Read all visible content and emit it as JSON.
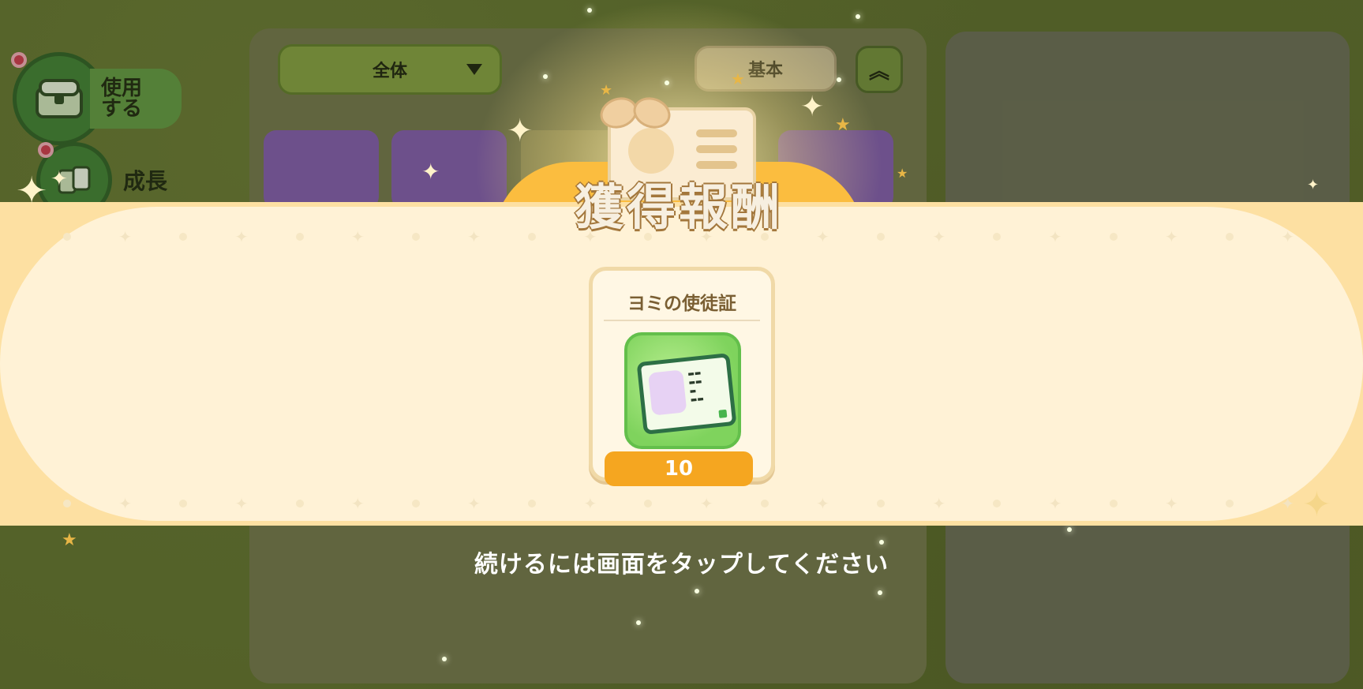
{
  "left_menu": {
    "use_label": "使用\nする",
    "growth_label": "成長"
  },
  "toolbar": {
    "filter_value": "全体",
    "sort_label": "基本",
    "collapse_icon": "double-chevron-up"
  },
  "popup": {
    "title": "獲得報酬",
    "reward": {
      "name": "ヨミの使徒証",
      "quantity": "10",
      "icon": "id-card-icon"
    },
    "continue_hint": "続けるには画面をタップしてください"
  },
  "colors": {
    "background": "#5b6b2c",
    "banner": "#fff2d6",
    "title_plate": "#fbbd3f",
    "quantity_badge": "#f5a620"
  }
}
